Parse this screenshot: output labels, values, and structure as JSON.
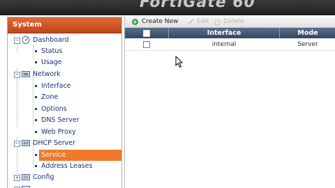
{
  "banner": {
    "logo_text": "FortiGate 60"
  },
  "sidebar": {
    "title": "System",
    "groups": [
      {
        "label": "Dashboard",
        "icon": "dashboard-icon",
        "expanded": true,
        "children": [
          "Status",
          "Usage"
        ]
      },
      {
        "label": "Network",
        "icon": "network-folder-icon",
        "expanded": true,
        "children": [
          "Interface",
          "Zone",
          "Options",
          "DNS Server",
          "Web Proxy"
        ]
      },
      {
        "label": "DHCP Server",
        "icon": "dhcp-folder-icon",
        "expanded": true,
        "children": [
          "Service",
          "Address Leases"
        ],
        "selected_child": "Service"
      },
      {
        "label": "Config",
        "icon": "config-folder-icon",
        "expanded": false,
        "children": []
      }
    ]
  },
  "toolbar": {
    "create_new": "Create New",
    "edit": "Edit",
    "delete": "Delete"
  },
  "grid": {
    "columns": [
      "Interface",
      "Mode"
    ],
    "rows": [
      {
        "interface": "internal",
        "mode": "Server"
      }
    ]
  },
  "colors": {
    "sidebar_header": "#c24617",
    "selected_item": "#f07a2a",
    "grid_header": "#34465e",
    "tree_text": "#1a2e7a"
  }
}
